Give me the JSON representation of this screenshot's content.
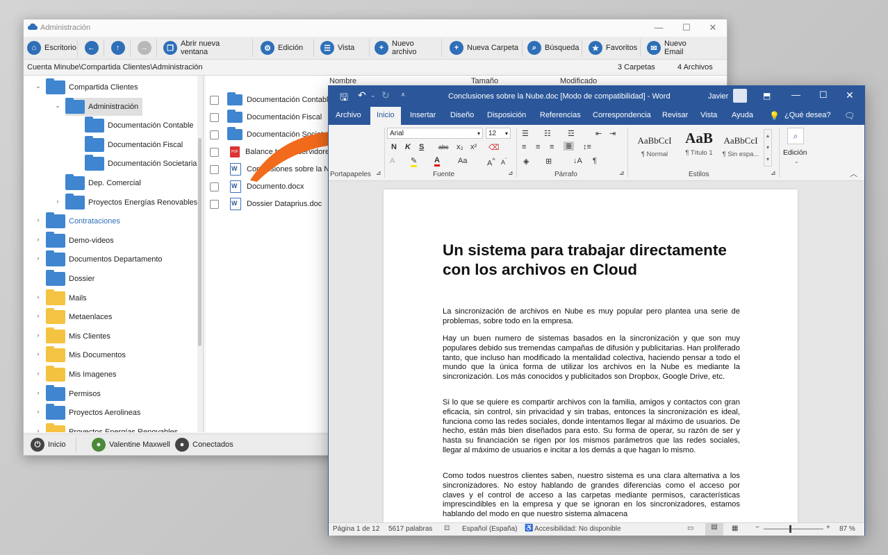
{
  "file_manager": {
    "title": "Administración",
    "toolbar": [
      {
        "label": "Escritorio",
        "icon": "home-icon"
      },
      {
        "label": "",
        "icon": "back-icon"
      },
      {
        "label": "",
        "icon": "up-icon"
      },
      {
        "label": "",
        "icon": "forward-icon"
      },
      {
        "label": "Abrir nueva ventana",
        "icon": "new-window-icon"
      },
      {
        "label": "Edición",
        "icon": "gear-icon"
      },
      {
        "label": "Vista",
        "icon": "list-view-icon"
      },
      {
        "label": "Nuevo archivo",
        "icon": "plus-icon"
      },
      {
        "label": "Nueva Carpeta",
        "icon": "plus-icon"
      },
      {
        "label": "Búsqueda",
        "icon": "search-icon"
      },
      {
        "label": "Favoritos",
        "icon": "star-icon"
      },
      {
        "label": "Nuevo Email",
        "icon": "mail-icon"
      }
    ],
    "path": "Cuenta Minube\\Compartida Clientes\\Administración",
    "folder_count": "3 Carpetas",
    "file_count": "4 Archivos",
    "tree": [
      {
        "label": "Compartida Clientes",
        "color": "blue",
        "level": 1,
        "expander": "⌄"
      },
      {
        "label": "Administración",
        "color": "blue",
        "level": 2,
        "expander": "⌄",
        "selected": true
      },
      {
        "label": "Documentación Contable",
        "color": "blue",
        "level": 3,
        "expander": ""
      },
      {
        "label": "Documentación Fiscal",
        "color": "blue",
        "level": 3,
        "expander": ""
      },
      {
        "label": "Documentación Societaria",
        "color": "blue",
        "level": 3,
        "expander": ""
      },
      {
        "label": "Dep. Comercial",
        "color": "blue",
        "level": 2,
        "expander": ""
      },
      {
        "label": "Proyectos Energías Renovables",
        "color": "blue",
        "level": 2,
        "expander": "›"
      },
      {
        "label": "Contrataciones",
        "color": "blue",
        "level": 0,
        "expander": "›",
        "link": true
      },
      {
        "label": "Demo-videos",
        "color": "blue",
        "level": 0,
        "expander": "›"
      },
      {
        "label": "Documentos Departamento",
        "color": "blue",
        "level": 0,
        "expander": "›"
      },
      {
        "label": "Dossier",
        "color": "blue",
        "level": 0,
        "expander": ""
      },
      {
        "label": "Mails",
        "color": "yellow",
        "level": 0,
        "expander": "›"
      },
      {
        "label": "Metaenlaces",
        "color": "yellow",
        "level": 0,
        "expander": "›"
      },
      {
        "label": "Mis Clientes",
        "color": "yellow",
        "level": 0,
        "expander": "›"
      },
      {
        "label": "Mis Documentos",
        "color": "yellow",
        "level": 0,
        "expander": "›"
      },
      {
        "label": "Mis Imagenes",
        "color": "yellow",
        "level": 0,
        "expander": "›"
      },
      {
        "label": "Permisos",
        "color": "blue",
        "level": 0,
        "expander": "›"
      },
      {
        "label": "Proyectos Aerolineas",
        "color": "blue",
        "level": 0,
        "expander": "›"
      },
      {
        "label": "Proyectos Energías Renovables",
        "color": "yellow",
        "level": 0,
        "expander": "›"
      }
    ],
    "columns": [
      "Nombre",
      "Tamaño",
      "Modificado"
    ],
    "files": [
      {
        "name": "Documentación Contable",
        "type": "folder"
      },
      {
        "name": "Documentación Fiscal",
        "type": "folder"
      },
      {
        "name": "Documentación Societaria",
        "type": "folder"
      },
      {
        "name": "Balance tráfico servidores",
        "type": "pdf"
      },
      {
        "name": "Conclusiones sobre la Nube.doc",
        "type": "doc"
      },
      {
        "name": "Documento.docx",
        "type": "doc"
      },
      {
        "name": "Dossier Dataprius.doc",
        "type": "doc"
      }
    ],
    "status": [
      {
        "label": "Inicio",
        "icon": "power-icon"
      },
      {
        "label": "Valentine Maxwell",
        "icon": "user-icon"
      },
      {
        "label": "Conectados",
        "icon": "users-icon"
      }
    ]
  },
  "word": {
    "title": "Conclusiones sobre la Nube.doc [Modo de compatibilidad] - Word",
    "user": "Javier",
    "tabs": [
      "Archivo",
      "Inicio",
      "Insertar",
      "Diseño",
      "Disposición",
      "Referencias",
      "Correspondencia",
      "Revisar",
      "Vista",
      "Ayuda"
    ],
    "active_tab": "Inicio",
    "tell_me": "¿Qué desea?",
    "font_name": "Arial",
    "font_size": "12",
    "groups": [
      "Portapapeles",
      "Fuente",
      "Párrafo",
      "Estilos",
      "Edición"
    ],
    "styles": [
      {
        "preview": "AaBbCcI",
        "name": "¶ Normal"
      },
      {
        "preview": "AaB",
        "name": "¶ Título 1"
      },
      {
        "preview": "AaBbCcI",
        "name": "¶ Sin espa..."
      }
    ],
    "doc_title": "Un sistema para trabajar directamente con los archivos en Cloud",
    "paragraphs": [
      "La sincronización de archivos en Nube es muy popular pero plantea una serie de problemas, sobre todo en la empresa.",
      "Hay un buen numero de sistemas basados en la sincronización y que son muy populares debido sus tremendas campañas de difusión y publicitarias. Han proliferado tanto, que incluso han modificado la mentalidad colectiva, haciendo pensar a todo el mundo que la única forma de utilizar los archivos en la Nube es mediante la sincronización. Los más conocidos y publicitados son Dropbox, Google Drive, etc.",
      "Si lo que se quiere es compartir archivos con la familia, amigos y contactos con gran eficacia, sin control, sin privacidad y sin trabas, entonces la sincronización es ideal, funciona como las redes sociales, donde intentamos llegar al máximo de usuarios. De hecho, están más bien diseñados para esto. Su forma de operar, su razón de ser y hasta su financiación se rigen por los mismos parámetros que las redes sociales, llegar al máximo de usuarios e incitar a los demás a que hagan lo mismo.",
      "Como todos nuestros clientes saben, nuestro sistema es una clara alternativa a los sincronizadores. No estoy hablando de grandes diferencias como el acceso por claves y el control de acceso a las carpetas mediante permisos, características imprescindibles en la empresa y que se ignoran en los sincronizadores, estamos hablando del modo en que nuestro sistema almacena"
    ],
    "status": {
      "page": "Página 1 de 12",
      "words": "5617 palabras",
      "language": "Español (España)",
      "accessibility": "Accesibilidad: No disponible",
      "zoom": "87 %"
    }
  },
  "colors": {
    "word_blue": "#2b579a",
    "folder_blue": "#3f85d0",
    "folder_yellow": "#f5c342",
    "arrow": "#f26a1b"
  }
}
